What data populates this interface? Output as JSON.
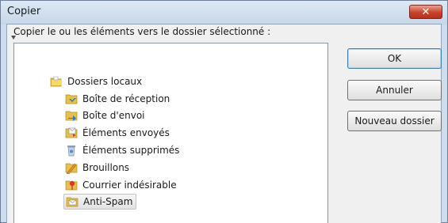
{
  "window": {
    "title": "Copier",
    "close_glyph": "✕"
  },
  "dialog": {
    "instruction": "Copier le ou les éléments vers le dossier sélectionné :"
  },
  "tree": {
    "root": {
      "label": "Dossiers locaux",
      "icon": "local-folders-icon",
      "expanded": true
    },
    "items": [
      {
        "label": "Boîte de réception",
        "icon": "inbox-icon"
      },
      {
        "label": "Boîte d'envoi",
        "icon": "outbox-icon"
      },
      {
        "label": "Éléments envoyés",
        "icon": "sent-items-icon"
      },
      {
        "label": "Éléments supprimés",
        "icon": "deleted-items-icon"
      },
      {
        "label": "Brouillons",
        "icon": "drafts-icon"
      },
      {
        "label": "Courrier indésirable",
        "icon": "junk-mail-icon"
      },
      {
        "label": "Anti-Spam",
        "icon": "folder-icon",
        "selected": true
      }
    ]
  },
  "buttons": {
    "ok": "OK",
    "cancel": "Annuler",
    "new_folder": "Nouveau dossier"
  },
  "colors": {
    "frame": "#cfdceb",
    "close": "#c8432b",
    "default_button_border": "#3c7fb1",
    "selection": "#e2e2e2"
  }
}
